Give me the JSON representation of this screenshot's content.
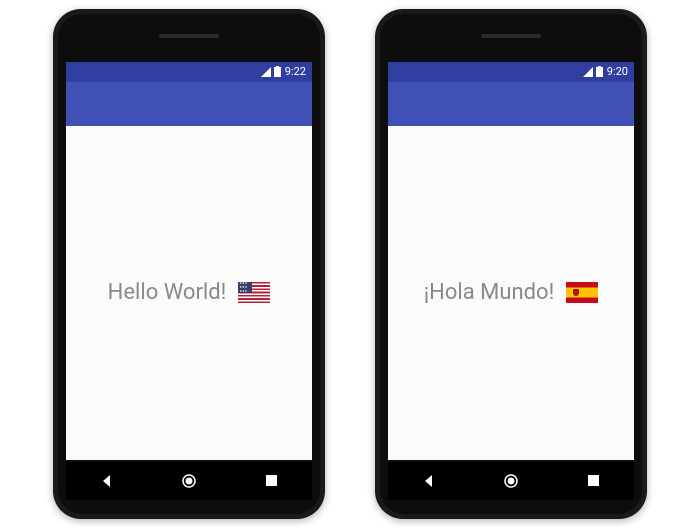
{
  "left": {
    "status": {
      "time": "9:22"
    },
    "greeting": "Hello World!",
    "flag": "usa"
  },
  "right": {
    "status": {
      "time": "9:20"
    },
    "greeting": "¡Hola Mundo!",
    "flag": "spain"
  },
  "colors": {
    "status_bar": "#303f9f",
    "app_bar": "#3f51b5"
  }
}
